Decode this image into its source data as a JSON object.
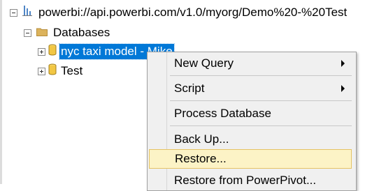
{
  "tree": {
    "server": {
      "label": "powerbi://api.powerbi.com/v1.0/myorg/Demo%20-%20Test",
      "icon": "server-icon"
    },
    "databases_folder": {
      "label": "Databases",
      "icon": "folder-icon"
    },
    "items": [
      {
        "label": "nyc taxi model - Mike",
        "icon": "database-icon",
        "selected": true
      },
      {
        "label": "Test",
        "icon": "database-icon",
        "selected": false
      }
    ]
  },
  "context_menu": {
    "items": [
      {
        "label": "New Query",
        "has_submenu": true
      },
      {
        "label": "Script",
        "has_submenu": true
      },
      {
        "label": "Process Database",
        "has_submenu": false
      },
      {
        "label": "Back Up...",
        "has_submenu": false
      },
      {
        "label": "Restore...",
        "has_submenu": false,
        "highlighted": true
      },
      {
        "label": "Restore from PowerPivot...",
        "has_submenu": false
      }
    ]
  },
  "colors": {
    "selection": "#0078d7",
    "menu_background": "#f0f0f0",
    "menu_highlight": "#fcf3c6",
    "folder": "#dcb35c",
    "database": "#f2c744"
  }
}
